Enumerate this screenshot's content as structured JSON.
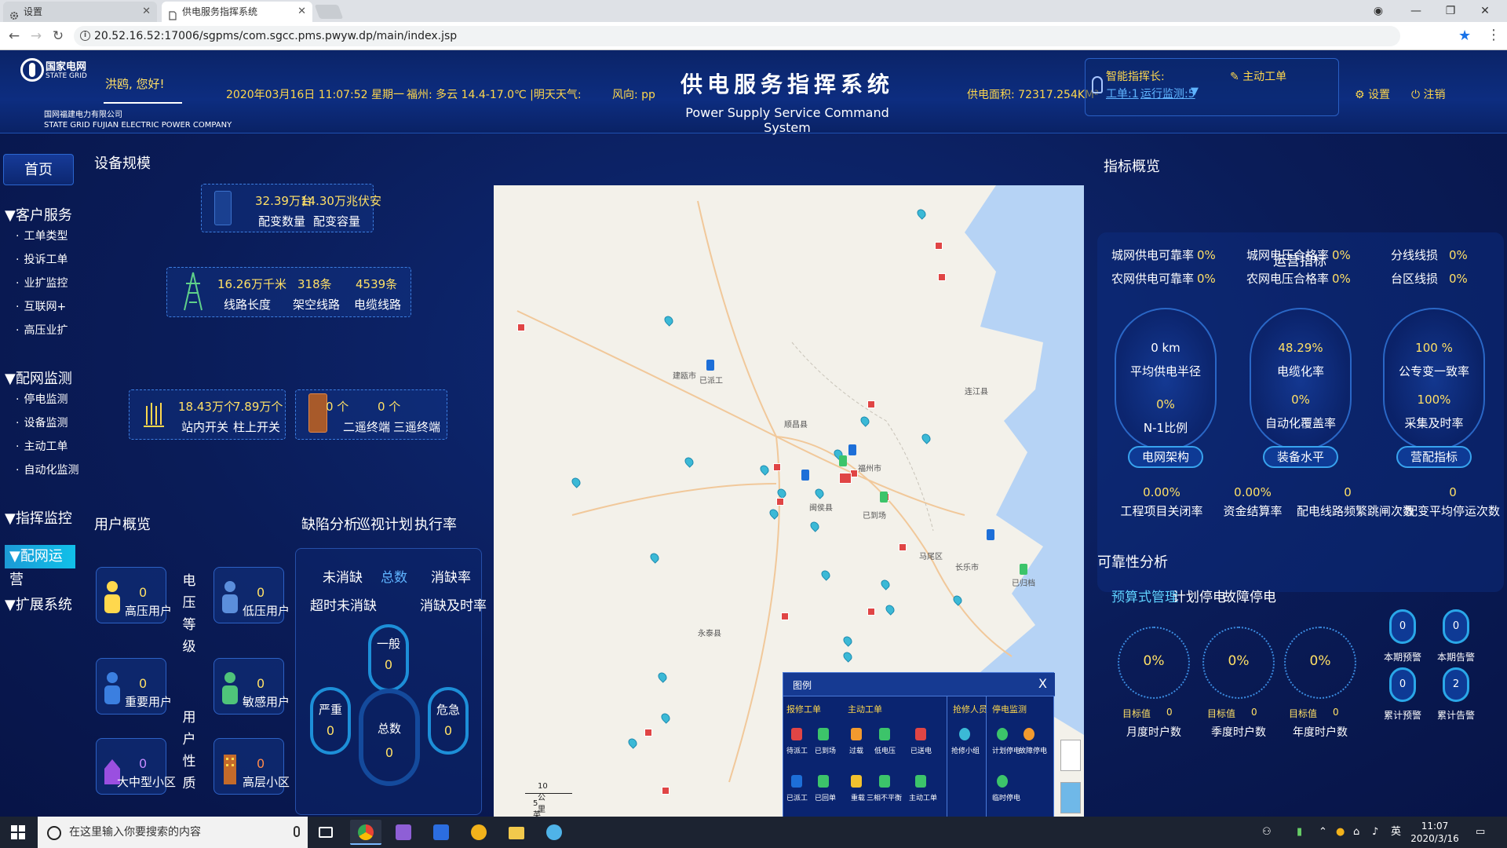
{
  "browser": {
    "tabs": [
      {
        "label": "设置",
        "icon": "gear-icon"
      },
      {
        "label": "供电服务指挥系统",
        "icon": "document-icon"
      }
    ],
    "url": "20.52.16.52:17006/sgpms/com.sgcc.pms.pwyw.dp/main/index.jsp"
  },
  "header": {
    "brand": "国家电网",
    "brand_en": "STATE GRID",
    "company": "国网福建电力有限公司",
    "company_en": "STATE GRID FUJIAN ELECTRIC POWER COMPANY",
    "greeting": "洪鸥, 您好!",
    "datetime": "2020年03月16日 11:07:52 星期一",
    "weather": "福州: 多云 14.4-17.0℃ |明天天气:",
    "wind": "风向: pp",
    "title": "供电服务指挥系统",
    "subtitle": "Power Supply Service Command System",
    "area": "供电面积: 72317.254KM²",
    "commander_label": "智能指挥长:",
    "commander_link1": "工单:1",
    "commander_link2": "运行监测:5",
    "active_order": "主动工单",
    "settings": "设置",
    "logout": "注销"
  },
  "sidebar": {
    "home": "首页",
    "sections": [
      {
        "label": "▼客户服务",
        "items": [
          "工单类型",
          "投诉工单",
          "业扩监控",
          "互联网+",
          "高压业扩"
        ]
      },
      {
        "label": "▼配网监测",
        "items": [
          "停电监测",
          "设备监测",
          "主动工单",
          "自动化监测"
        ]
      },
      {
        "label": "▼指挥监控",
        "items": []
      },
      {
        "label": "▼配网运营",
        "items": []
      },
      {
        "label": "▼扩展系统",
        "items": []
      }
    ]
  },
  "equipment": {
    "title": "设备规模",
    "dist_num1": "32.39万台",
    "dist_num2": "14.30万兆伏安",
    "dist_lbl1": "配变数量",
    "dist_lbl2": "配变容量",
    "line_num1": "16.26万千米",
    "line_num2": "318条",
    "line_num3": "4539条",
    "line_lbl1": "线路长度",
    "line_lbl2": "架空线路",
    "line_lbl3": "电缆线路",
    "sw_num1": "18.43万个",
    "sw_num2": "7.89万个",
    "sw_lbl1": "站内开关",
    "sw_lbl2": "柱上开关",
    "term_num1": "0 个",
    "term_num2": "0 个",
    "term_lbl1": "二遥终端",
    "term_lbl2": "三遥终端"
  },
  "users": {
    "title": "用户概览",
    "voltage_label": "电压等级",
    "nature_label": "用户性质",
    "cards": [
      {
        "value": "0",
        "label": "高压用户"
      },
      {
        "value": "0",
        "label": "低压用户"
      },
      {
        "value": "0",
        "label": "重要用户"
      },
      {
        "value": "0",
        "label": "敏感用户"
      },
      {
        "value": "0",
        "label": "大中型小区"
      },
      {
        "value": "0",
        "label": "高层小区"
      }
    ]
  },
  "defect": {
    "tabs": [
      "缺陷分析",
      "巡视计划",
      "执行率"
    ],
    "row1": [
      "未消缺",
      "总数",
      "消缺率"
    ],
    "row2": [
      "超时未消缺",
      "消缺及时率"
    ],
    "general": "一般",
    "general_val": "0",
    "serious": "严重",
    "serious_val": "0",
    "total": "总数",
    "total_val": "0",
    "critical": "危急",
    "critical_val": "0"
  },
  "map": {
    "cities": [
      "建瓯市",
      "已派工",
      "顺昌县",
      "闽侯县",
      "福州市",
      "连江县",
      "已到场",
      "马尾区",
      "长乐市",
      "永泰县",
      "已归档"
    ],
    "scale_top": "10 公里",
    "scale_bottom": "5 英里",
    "legend": {
      "title": "图例",
      "close": "X",
      "sections": [
        "报修工单",
        "主动工单",
        "抢修人员",
        "停电监测"
      ],
      "items_repair": [
        "待派工",
        "已到场",
        "已派工",
        "已回单"
      ],
      "items_active": [
        "过载",
        "低电压",
        "已送电",
        "三相不平衡",
        "重载",
        "主动工单"
      ],
      "items_staff": [
        "抢修小组"
      ],
      "items_outage": [
        "计划停电",
        "故障停电",
        "临时停电"
      ]
    }
  },
  "indicators": {
    "title": "指标概览",
    "op_title": "运营指标",
    "metrics": [
      {
        "label": "城网供电可靠率",
        "value": "0%"
      },
      {
        "label": "农网供电可靠率",
        "value": "0%"
      },
      {
        "label": "城网电压合格率",
        "value": "0%"
      },
      {
        "label": "农网电压合格率",
        "value": "0%"
      },
      {
        "label": "分线线损",
        "value": "0%"
      },
      {
        "label": "台区线损",
        "value": "0%"
      }
    ],
    "gauges": [
      {
        "top_val": "0 km",
        "top_lbl": "平均供电半径",
        "mid_val": "0%",
        "mid_lbl": "N-1比例",
        "btn": "电网架构"
      },
      {
        "top_val": "48.29%",
        "top_lbl": "电缆化率",
        "mid_val": "0%",
        "mid_lbl": "自动化覆盖率",
        "btn": "装备水平"
      },
      {
        "top_val": "100 %",
        "top_lbl": "公专变一致率",
        "mid_val": "100%",
        "mid_lbl": "采集及时率",
        "btn": "营配指标"
      }
    ],
    "bottom": [
      {
        "value": "0.00%",
        "label": "工程项目关闭率"
      },
      {
        "value": "0.00%",
        "label": "资金结算率"
      },
      {
        "value": "0",
        "label": "配电线路频繁跳闸次数"
      },
      {
        "value": "0",
        "label": "配变平均停运次数"
      }
    ]
  },
  "reliability": {
    "title": "可靠性分析",
    "tabs": [
      "预算式管理",
      "计划停电",
      "故障停电"
    ],
    "gauges": [
      {
        "pct": "0%",
        "target_lbl": "目标值",
        "target_val": "0",
        "label": "月度时户数"
      },
      {
        "pct": "0%",
        "target_lbl": "目标值",
        "target_val": "0",
        "label": "季度时户数"
      },
      {
        "pct": "0%",
        "target_lbl": "目标值",
        "target_val": "0",
        "label": "年度时户数"
      }
    ],
    "warnings": [
      {
        "value": "0",
        "label": "本期预警"
      },
      {
        "value": "0",
        "label": "本期告警"
      },
      {
        "value": "0",
        "label": "累计预警"
      },
      {
        "value": "2",
        "label": "累计告警"
      }
    ]
  },
  "taskbar": {
    "search_placeholder": "在这里输入你要搜索的内容",
    "ime": "英",
    "time": "11:07",
    "date": "2020/3/16"
  },
  "colors": {
    "accent_yellow": "#ffe066",
    "accent_cyan": "#1d8fd8",
    "bg_dark": "#0a1c58"
  }
}
